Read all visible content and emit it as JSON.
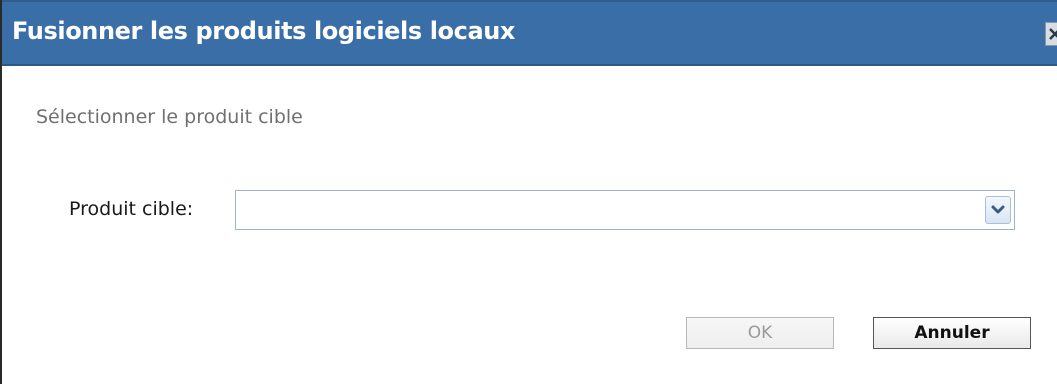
{
  "dialog": {
    "title": "Fusionner les produits logiciels locaux",
    "close_icon": "close-icon"
  },
  "section": {
    "heading": "Sélectionner le produit cible"
  },
  "form": {
    "target_label": "Produit cible:",
    "target_value": "",
    "dropdown_icon": "chevron-down-icon"
  },
  "buttons": {
    "ok_label": "OK",
    "ok_enabled": false,
    "cancel_label": "Annuler"
  },
  "colors": {
    "titlebar": "#3a6ea7",
    "title_text": "#ffffff",
    "section_text": "#707070"
  }
}
